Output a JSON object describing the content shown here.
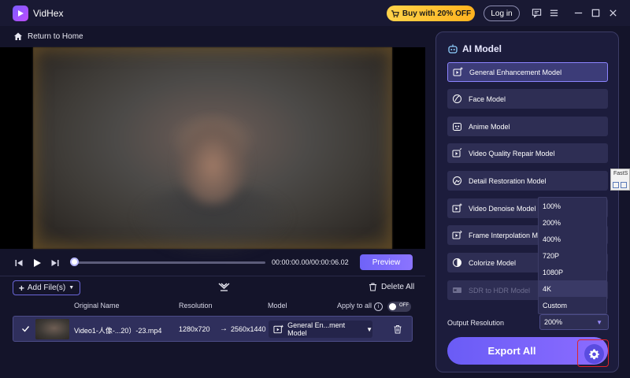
{
  "app": {
    "name": "VidHex"
  },
  "titlebar": {
    "buy_label": "Buy with 20% OFF",
    "login_label": "Log in"
  },
  "nav": {
    "back_label": "Return to Home"
  },
  "player": {
    "time": "00:00:00.00/00:00:06.02",
    "preview_label": "Preview",
    "progress": 0.01
  },
  "files": {
    "add_label": "Add File(s)",
    "delete_all_label": "Delete All",
    "headers": {
      "name": "Original Name",
      "resolution": "Resolution",
      "model": "Model",
      "apply_all": "Apply to all"
    },
    "toggle_label": "OFF",
    "rows": [
      {
        "name": "Video1-人像-...20）-23.mp4",
        "res_in": "1280x720",
        "arrow": "→",
        "res_out": "2560x1440",
        "model": "General En...ment Model"
      }
    ]
  },
  "ai_panel": {
    "title": "AI Model",
    "models": [
      {
        "label": "General Enhancement Model",
        "icon": "general-enhancement-icon"
      },
      {
        "label": "Face Model",
        "icon": "face-icon"
      },
      {
        "label": "Anime Model",
        "icon": "anime-icon"
      },
      {
        "label": "Video Quality Repair Model",
        "icon": "quality-repair-icon"
      },
      {
        "label": "Detail Restoration Model",
        "icon": "detail-restoration-icon"
      },
      {
        "label": "Video Denoise Model",
        "icon": "denoise-icon"
      },
      {
        "label": "Frame Interpolation Mo",
        "icon": "frame-interpolation-icon"
      },
      {
        "label": "Colorize Model",
        "icon": "colorize-icon"
      },
      {
        "label": "SDR to HDR Model",
        "icon": "hdr-icon"
      }
    ],
    "output_label": "Output Resolution",
    "output_value": "200%",
    "resolution_options": [
      "100%",
      "200%",
      "400%",
      "720P",
      "1080P",
      "4K",
      "Custom"
    ],
    "export_label": "Export All"
  },
  "edge_widget": {
    "text": "FastS"
  },
  "colors": {
    "accent": "#6f63f7",
    "buy": "#ffc430",
    "highlight": "#e0232a"
  }
}
